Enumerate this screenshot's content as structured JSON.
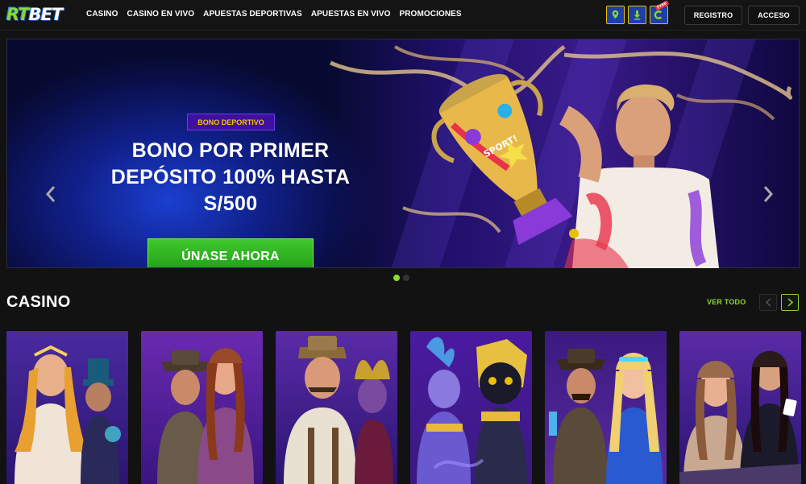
{
  "header": {
    "logo_rt": "RT",
    "logo_bet": "BET",
    "nav": [
      "CASINO",
      "CASINO EN VIVO",
      "APUESTAS DEPORTIVAS",
      "APUESTAS EN VIVO",
      "PROMOCIONES"
    ],
    "quick_icons": [
      "location-pin-icon",
      "download-icon",
      "free-coin-icon"
    ],
    "free_tag": "Free",
    "register_label": "REGISTRO",
    "login_label": "ACCESO"
  },
  "banner": {
    "tag": "BONO DEPORTIVO",
    "title": "BONO POR PRIMER DEPÓSITO 100% HASTA S/500",
    "cta_label": "ÚNASE AHORA",
    "trophy_text": "SPORT!",
    "slides_total": 2,
    "active_slide": 1
  },
  "casino": {
    "title": "CASINO",
    "see_all_label": "VER TODO",
    "games": [
      "game-goddess-sorcerer",
      "game-adventurers",
      "game-explorer-jester",
      "game-genie-cat-pharaoh",
      "game-wizard-cowboy",
      "game-live-dealers"
    ]
  },
  "colors": {
    "accent_green": "#8ad82b",
    "promo_tag_text": "#f6c300",
    "background": "#121212"
  }
}
